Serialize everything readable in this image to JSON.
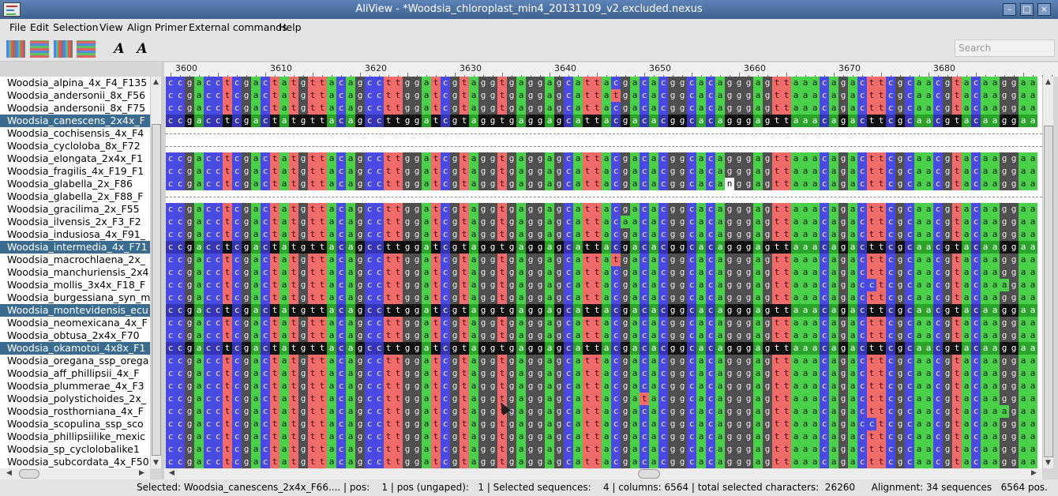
{
  "window": {
    "title": "AliView - *Woodsia_chloroplast_min4_20131109_v2.excluded.nexus"
  },
  "menu": [
    "File",
    "Edit",
    "Selection",
    "View",
    "Align",
    "Primer",
    "External commands",
    "Help"
  ],
  "search": {
    "placeholder": "Search"
  },
  "ruler": {
    "labels": [
      "3600",
      "3610",
      "3620",
      "3630",
      "3640",
      "3650",
      "3660",
      "3670",
      "3680"
    ]
  },
  "sequences": [
    {
      "name": "Woodsia_alpina_4x_F4_F135",
      "selected": false
    },
    {
      "name": "Woodsia_andersonii_8x_F56",
      "selected": false
    },
    {
      "name": "Woodsia_andersonii_8x_F75",
      "selected": false
    },
    {
      "name": "Woodsia_canescens_2x4x_F",
      "selected": true
    },
    {
      "name": "Woodsia_cochisensis_4x_F4",
      "selected": false
    },
    {
      "name": "Woodsia_cycloloba_8x_F72",
      "selected": false
    },
    {
      "name": "Woodsia_elongata_2x4x_F1",
      "selected": false
    },
    {
      "name": "Woodsia_fragilis_4x_F19_F1",
      "selected": false
    },
    {
      "name": "Woodsia_glabella_2x_F86",
      "selected": false
    },
    {
      "name": "Woodsia_glabella_2x_F88_F",
      "selected": false
    },
    {
      "name": "Woodsia_gracilima_2x_F55",
      "selected": false
    },
    {
      "name": "Woodsia_ilvensis_2x_F3_F2",
      "selected": false
    },
    {
      "name": "Woodsia_indusiosa_4x_F91_",
      "selected": false
    },
    {
      "name": "Woodsia_intermedia_4x_F71",
      "selected": true
    },
    {
      "name": "Woodsia_macrochlaena_2x_",
      "selected": false
    },
    {
      "name": "Woodsia_manchuriensis_2x4",
      "selected": false
    },
    {
      "name": "Woodsia_mollis_3x4x_F18_F",
      "selected": false
    },
    {
      "name": "Woodsia_burgessiana_syn_m",
      "selected": false
    },
    {
      "name": "Woodsia_montevidensis_ecu",
      "selected": true
    },
    {
      "name": "Woodsia_neomexicana_4x_F",
      "selected": false
    },
    {
      "name": "Woodsia_obtusa_2x4x_F70",
      "selected": false
    },
    {
      "name": "Woodsia_okamotoi_4x8x_F1",
      "selected": true
    },
    {
      "name": "Woodsia_oregana_ssp_orega",
      "selected": false
    },
    {
      "name": "Woodsia_aff_phillipsii_4x_F",
      "selected": false
    },
    {
      "name": "Woodsia_plummerae_4x_F3",
      "selected": false
    },
    {
      "name": "Woodsia_polystichoides_2x_",
      "selected": false
    },
    {
      "name": "Woodsia_rosthorniana_4x_F",
      "selected": false
    },
    {
      "name": "Woodsia_scopulina_ssp_sco",
      "selected": false
    },
    {
      "name": "Woodsia_phillipsiilike_mexic",
      "selected": false
    },
    {
      "name": "Woodsia_sp_cyclolobalike1",
      "selected": false
    },
    {
      "name": "Woodsia_subcordata_4x_F50",
      "selected": false
    }
  ],
  "alignment": {
    "consensus": "ccgacctcgactatgttacagccttggatcgtaggtgaggagcattacgacacggcacagggagttaaacagacttcgcaacgtacaaggaa",
    "gap_rows": [
      4,
      5,
      9
    ],
    "variants": [
      {
        "row": 1,
        "col": 47,
        "base": "t"
      },
      {
        "row": 8,
        "col": 59,
        "base": "n"
      },
      {
        "row": 11,
        "col": 48,
        "base": "a"
      },
      {
        "row": 14,
        "col": 45,
        "base": "t"
      },
      {
        "row": 14,
        "col": 47,
        "base": "t"
      },
      {
        "row": 16,
        "col": 74,
        "base": "c"
      },
      {
        "row": 16,
        "col": 88,
        "base": "a"
      },
      {
        "row": 25,
        "col": 50,
        "base": "t"
      },
      {
        "row": 26,
        "col": 88,
        "base": "a"
      },
      {
        "row": 27,
        "col": 74,
        "base": "c"
      }
    ]
  },
  "colors": {
    "a": "#4ad14a",
    "c": "#4a4ae3",
    "g": "#4f4f4f",
    "t": "#f26b6b",
    "n": "#ffffff",
    "selected_row": "#101010",
    "selection_name": "#3a6c8f"
  },
  "status": {
    "left": "Selected: Woodsia_canescens_2x4x_F66.... | pos:    1 | pos (ungaped):   1 | Selected sequences:    4 | columns: 6564 | total selected characters:  26260",
    "right": "Alignment: 34 sequences   6564 pos."
  }
}
